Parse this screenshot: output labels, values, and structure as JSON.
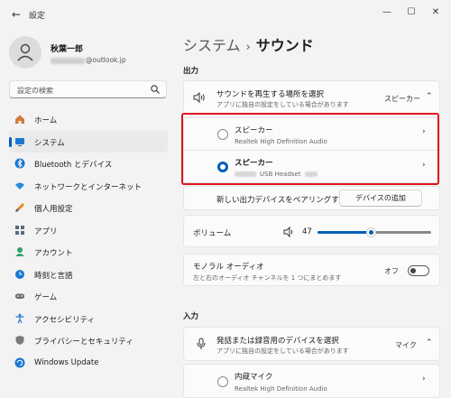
{
  "window": {
    "title": "設定",
    "back_icon": "back-arrow-icon",
    "controls": [
      "minimize-icon",
      "maximize-icon",
      "close-icon"
    ]
  },
  "profile": {
    "name": "秋葉一郎",
    "email_domain": "@outlook.jp"
  },
  "search": {
    "placeholder": "設定の検索"
  },
  "nav": [
    {
      "label": "ホーム",
      "icon": "home-icon"
    },
    {
      "label": "システム",
      "icon": "monitor-icon",
      "active": true
    },
    {
      "label": "Bluetooth とデバイス",
      "icon": "bluetooth-icon"
    },
    {
      "label": "ネットワークとインターネット",
      "icon": "wifi-icon"
    },
    {
      "label": "個人用設定",
      "icon": "brush-icon"
    },
    {
      "label": "アプリ",
      "icon": "apps-icon"
    },
    {
      "label": "アカウント",
      "icon": "account-icon"
    },
    {
      "label": "時刻と言語",
      "icon": "globe-clock-icon"
    },
    {
      "label": "ゲーム",
      "icon": "gamepad-icon"
    },
    {
      "label": "アクセシビリティ",
      "icon": "accessibility-icon"
    },
    {
      "label": "プライバシーとセキュリティ",
      "icon": "shield-icon"
    },
    {
      "label": "Windows Update",
      "icon": "update-icon"
    }
  ],
  "breadcrumb": {
    "parent": "システム",
    "separator": "›",
    "current": "サウンド"
  },
  "output": {
    "heading": "出力",
    "selector": {
      "title": "サウンドを再生する場所を選択",
      "subtitle": "アプリに独自の設定をしている場合があります",
      "value": "スピーカー"
    },
    "devices": [
      {
        "name": "スピーカー",
        "detail": "Realtek High Definition Audio",
        "selected": false
      },
      {
        "name": "スピーカー",
        "detail": "USB Headset",
        "selected": true
      }
    ],
    "pair": {
      "label": "新しい出力デバイスをペアリングする",
      "button": "デバイスの追加"
    },
    "volume": {
      "label": "ボリューム",
      "value": "47",
      "level": 0.47
    },
    "mono": {
      "title": "モノラル オーディオ",
      "subtitle": "左と右のオーディオ チャンネルを 1 つにまとめます",
      "state": "オフ"
    }
  },
  "input": {
    "heading": "入力",
    "selector": {
      "title": "発話または録音用のデバイスを選択",
      "subtitle": "アプリに独自の設定をしている場合があります",
      "value": "マイク"
    },
    "devices": [
      {
        "name": "内蔵マイク",
        "detail": "Realtek High Definition Audio",
        "selected": false
      }
    ]
  },
  "colors": {
    "accent": "#005fb8",
    "highlight": "#e0141e",
    "background": "#f3f3f3"
  }
}
